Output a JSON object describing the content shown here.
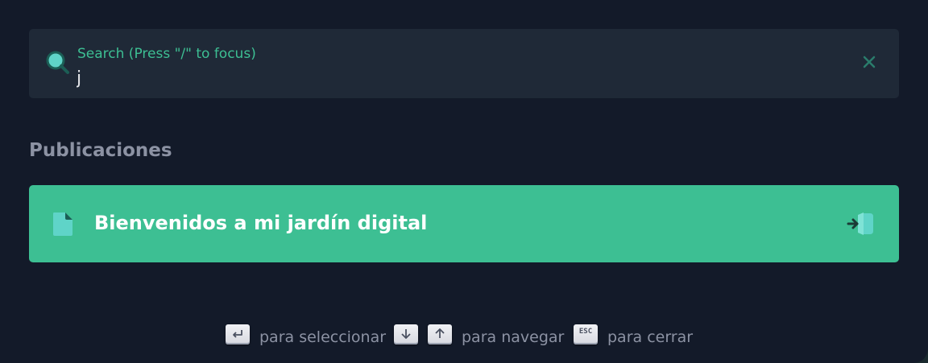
{
  "search": {
    "label": "Search (Press \"/\" to focus)",
    "value": "j"
  },
  "results": {
    "section_title": "Publicaciones",
    "hits": [
      {
        "title": "Bienvenidos a mi jardín digital",
        "icon": "document-icon"
      }
    ]
  },
  "footer": {
    "select_label": "para seleccionar",
    "navigate_label": "para navegar",
    "close_label": "para cerrar",
    "esc_key": "ESC"
  },
  "colors": {
    "accent": "#3dbf93",
    "background": "#131a29",
    "search_background": "#1f2937",
    "muted_text": "#8c92a3"
  }
}
